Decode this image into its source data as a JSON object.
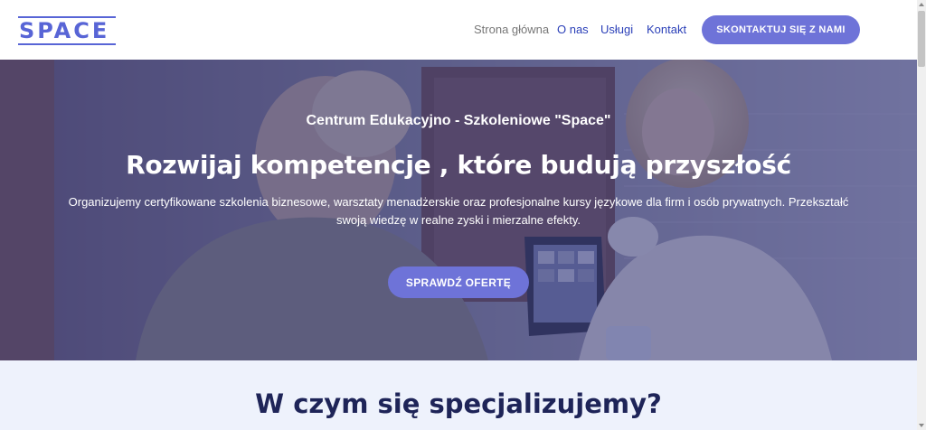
{
  "header": {
    "logo_text": "SPACE",
    "nav": [
      {
        "label": "Strona główna"
      },
      {
        "label": "O nas"
      },
      {
        "label": "Usługi"
      },
      {
        "label": "Kontakt"
      }
    ],
    "cta_label": "SKONTAKTUJ SIĘ Z NAMI"
  },
  "hero": {
    "eyebrow": "Centrum Edukacyjno - Szkoleniowe \"Space\"",
    "title": "Rozwijaj kompetencje , które budują przyszłość",
    "description": "Organizujemy certyfikowane szkolenia biznesowe, warsztaty menadżerskie oraz profesjonalne kursy językowe dla firm i osób prywatnych. Przekształć swoją wiedzę w realne zyski i mierzalne efekty.",
    "button_label": "SPRAWDŹ OFERTĘ"
  },
  "section": {
    "title": "W czym się specjalizujemy?"
  },
  "colors": {
    "accent": "#6e73d8",
    "logo": "#5865d6",
    "nav_link": "#2a3fb8",
    "heading_dark": "#1e2458",
    "section_bg": "#eef2fc"
  }
}
